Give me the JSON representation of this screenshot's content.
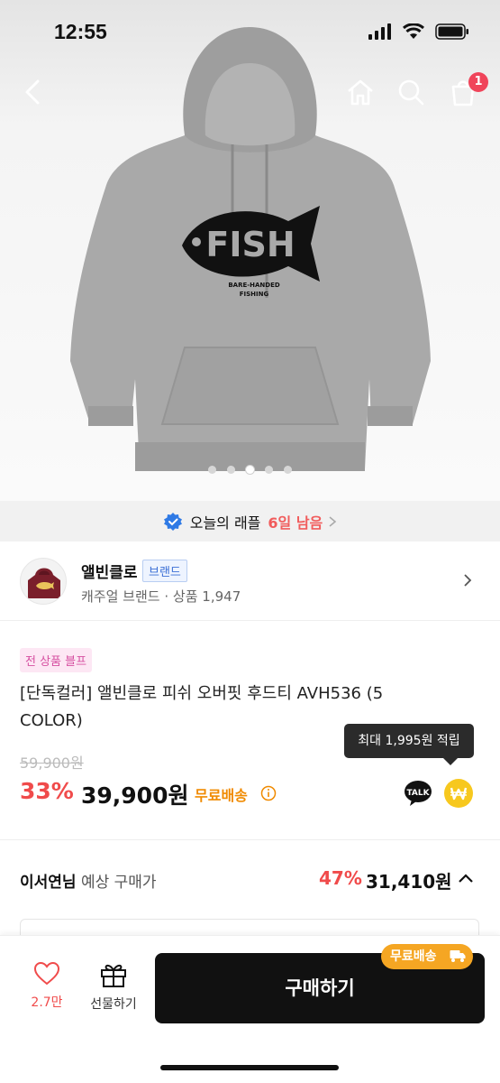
{
  "status_bar": {
    "time": "12:55"
  },
  "nav": {
    "cart_count": "1"
  },
  "gallery": {
    "image_count": 5,
    "active_index": 2,
    "print_text": "FISH",
    "print_sub1": "BARE-HANDED",
    "print_sub2": "FISHING"
  },
  "raffle": {
    "label": "오늘의 래플",
    "days_left": "6일 남음"
  },
  "brand": {
    "name": "앨빈클로",
    "tag": "브랜드",
    "category": "캐주얼 브랜드",
    "dot": "·",
    "product_count": "상품 1,947"
  },
  "product": {
    "promo": "전 상품 블프",
    "title": "[단독컬러] 앨빈클로 피쉬 오버핏 후드티 AVH536 (5 COLOR)",
    "tooltip": "최대 1,995원 적립",
    "original_price": "59,900원",
    "discount": "33%",
    "price": "39,900원",
    "shipping": "무료배송",
    "talk_label": "TALK"
  },
  "expected": {
    "user": "이서연님",
    "label": " 예상 구매가",
    "rate": "47%",
    "price": "31,410원"
  },
  "bottom": {
    "like_count": "2.7만",
    "gift_label": "선물하기",
    "buy_label": "구매하기",
    "ship_badge": "무료배송"
  },
  "colors": {
    "accent_red": "#f04b4b",
    "shipping_orange": "#f08a00",
    "buy_bg": "#111111",
    "promo_pink": "#d64fa1"
  }
}
